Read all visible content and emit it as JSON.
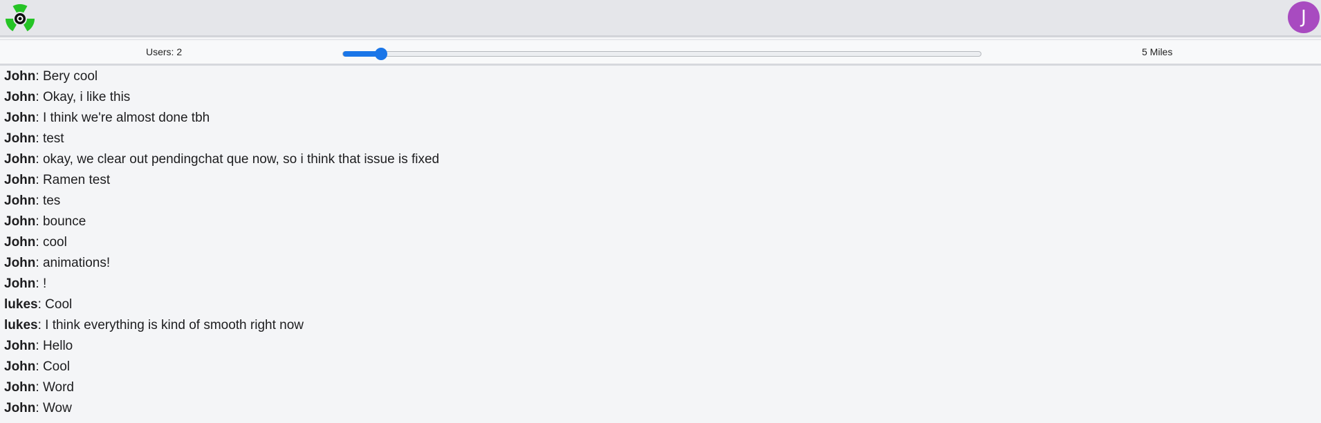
{
  "header": {
    "logo_icon": "radiation-symbol-icon",
    "logo_colors": {
      "primary": "#25c425",
      "center": "#111111"
    },
    "avatar_initial": "J",
    "avatar_color": "#a84bc0"
  },
  "controls": {
    "users_label": "Users: 2",
    "distance_label": "5 Miles",
    "slider_value_fraction": 0.06,
    "slider_color": "#1a76e8"
  },
  "messages": [
    {
      "author": "John",
      "text": ": Bery cool"
    },
    {
      "author": "John",
      "text": ": Okay, i like this"
    },
    {
      "author": "John",
      "text": ": I think we're almost done tbh"
    },
    {
      "author": "John",
      "text": ": test"
    },
    {
      "author": "John",
      "text": ": okay, we clear out pendingchat que now, so i think that issue is fixed"
    },
    {
      "author": "John",
      "text": ": Ramen test"
    },
    {
      "author": "John",
      "text": ": tes"
    },
    {
      "author": "John",
      "text": ": bounce"
    },
    {
      "author": "John",
      "text": ": cool"
    },
    {
      "author": "John",
      "text": ": animations!"
    },
    {
      "author": "John",
      "text": ": !"
    },
    {
      "author": "lukes",
      "text": ": Cool"
    },
    {
      "author": "lukes",
      "text": ": I think everything is kind of smooth right now"
    },
    {
      "author": "John",
      "text": ": Hello"
    },
    {
      "author": "John",
      "text": ": Cool"
    },
    {
      "author": "John",
      "text": ": Word"
    },
    {
      "author": "John",
      "text": ": Wow"
    }
  ]
}
